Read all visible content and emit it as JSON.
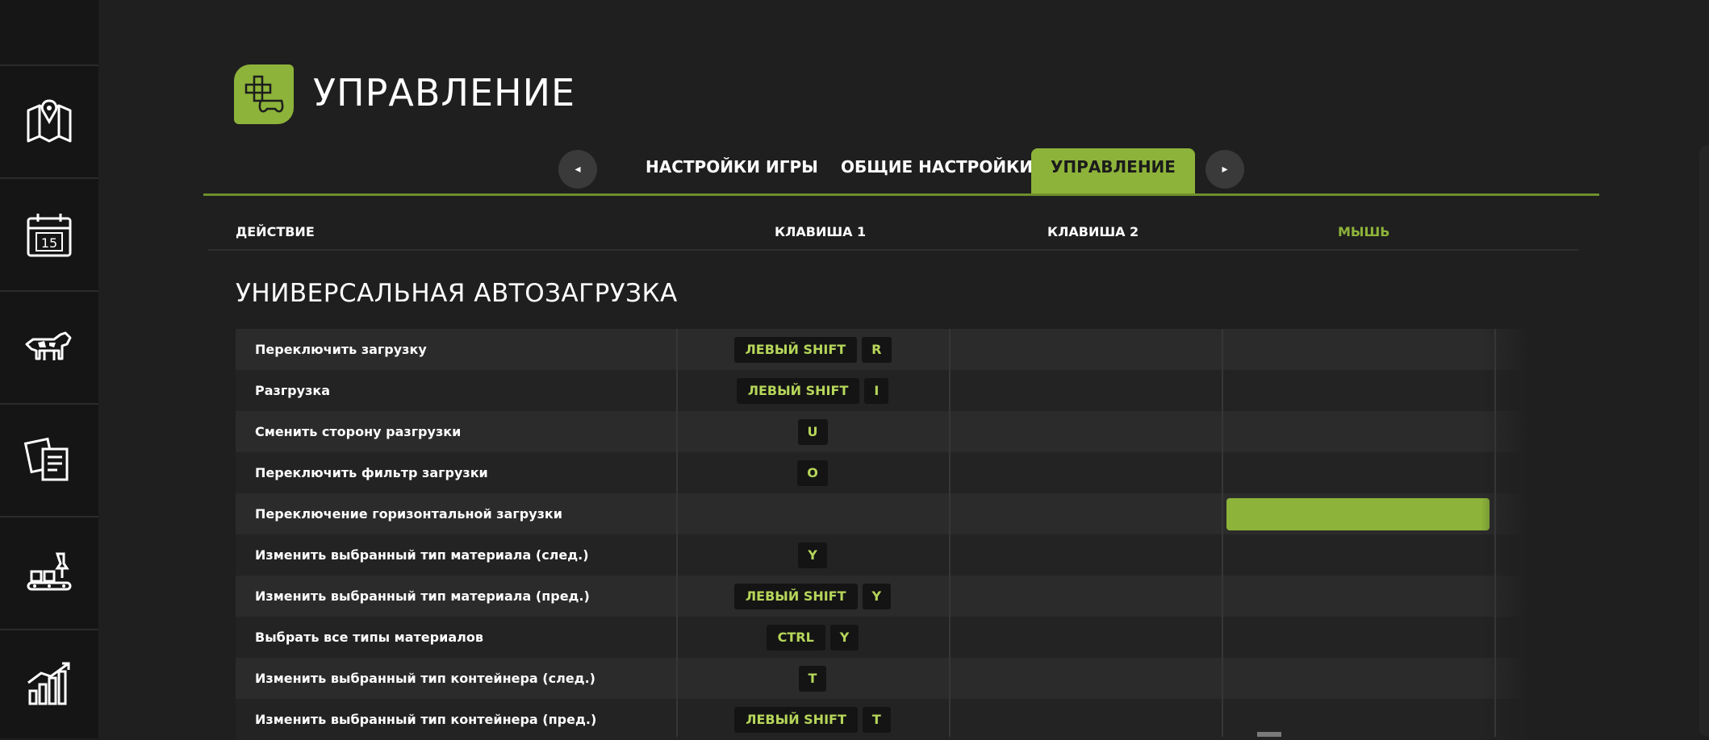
{
  "sidebar": {
    "items": [
      {
        "icon": "map-pin-icon"
      },
      {
        "icon": "calendar-icon",
        "day": "15"
      },
      {
        "icon": "animals-icon"
      },
      {
        "icon": "contracts-icon"
      },
      {
        "icon": "production-icon"
      },
      {
        "icon": "statistics-icon"
      }
    ]
  },
  "header": {
    "title": "УПРАВЛЕНИЕ",
    "icon": "controls-icon"
  },
  "tabs": [
    {
      "label": "НАСТРОЙКИ ИГРЫ",
      "active": false
    },
    {
      "label": "ОБЩИЕ НАСТРОЙКИ",
      "active": false
    },
    {
      "label": "УПРАВЛЕНИЕ",
      "active": true
    }
  ],
  "columns": {
    "action": "ДЕЙСТВИЕ",
    "key1": "КЛАВИША 1",
    "key2": "КЛАВИША 2",
    "mouse": "МЫШЬ"
  },
  "section": {
    "title": "УНИВЕРСАЛЬНАЯ АВТОЗАГРУЗКА"
  },
  "rows": [
    {
      "label": "Переключить загрузку",
      "key1": [
        "ЛЕВЫЙ SHIFT",
        "R"
      ],
      "key2": [],
      "mouse": ""
    },
    {
      "label": "Разгрузка",
      "key1": [
        "ЛЕВЫЙ SHIFT",
        "I"
      ],
      "key2": [],
      "mouse": ""
    },
    {
      "label": "Сменить сторону разгрузки",
      "key1": [
        "U"
      ],
      "key2": [],
      "mouse": ""
    },
    {
      "label": "Переключить фильтр загрузки",
      "key1": [
        "O"
      ],
      "key2": [],
      "mouse": ""
    },
    {
      "label": "Переключение горизонтальной загрузки",
      "key1": [],
      "key2": [],
      "mouse": "",
      "mouse_selected": true
    },
    {
      "label": "Изменить выбранный тип материала (след.)",
      "key1": [
        "Y"
      ],
      "key2": [],
      "mouse": ""
    },
    {
      "label": "Изменить выбранный тип материала (пред.)",
      "key1": [
        "ЛЕВЫЙ SHIFT",
        "Y"
      ],
      "key2": [],
      "mouse": ""
    },
    {
      "label": "Выбрать все типы материалов",
      "key1": [
        "CTRL",
        "Y"
      ],
      "key2": [],
      "mouse": ""
    },
    {
      "label": "Изменить выбранный тип контейнера (след.)",
      "key1": [
        "T"
      ],
      "key2": [],
      "mouse": ""
    },
    {
      "label": "Изменить выбранный тип контейнера (пред.)",
      "key1": [
        "ЛЕВЫЙ SHIFT",
        "T"
      ],
      "key2": [],
      "mouse": ""
    }
  ],
  "colors": {
    "accent": "#8db33a",
    "key_text": "#b6d65a"
  }
}
